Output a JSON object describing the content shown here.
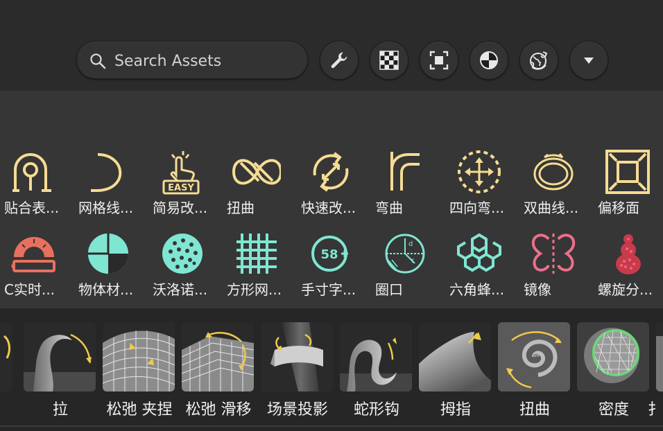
{
  "search": {
    "placeholder": "Search Assets"
  },
  "toolbar": {
    "buttons": [
      {
        "icon": "wrench-icon"
      },
      {
        "icon": "checkerboard-icon"
      },
      {
        "icon": "frame-icon"
      },
      {
        "icon": "material-sphere-icon"
      },
      {
        "icon": "globe-icon"
      },
      {
        "icon": "dropdown-arrow-icon"
      }
    ]
  },
  "colors": {
    "yellow": "#f6dc93",
    "salmon": "#e8705f",
    "mint": "#7fe6d2",
    "pink": "#ee6f8a",
    "red": "#c93a4a",
    "accent_arrow": "#f2c94c",
    "green_ring": "#6fd47a"
  },
  "grid": {
    "row1": [
      {
        "label": "贴合表...",
        "icon": "fit-surface-icon"
      },
      {
        "label": "网格线...",
        "icon": "mesh-curve-icon"
      },
      {
        "label": "简易改...",
        "icon": "easy-modify-icon"
      },
      {
        "label": "扭曲",
        "icon": "twist-icon"
      },
      {
        "label": "快速改...",
        "icon": "quick-modify-icon"
      },
      {
        "label": "弯曲",
        "icon": "bend-icon"
      },
      {
        "label": "四向弯...",
        "icon": "four-way-bend-icon"
      },
      {
        "label": "双曲线...",
        "icon": "double-curve-icon"
      },
      {
        "label": "偏移面",
        "icon": "offset-face-icon"
      }
    ],
    "row2": [
      {
        "label": "C实时...",
        "icon": "protractor-icon"
      },
      {
        "label": "物体材...",
        "icon": "object-material-icon"
      },
      {
        "label": "沃洛诺...",
        "icon": "voronoi-icon"
      },
      {
        "label": "方形网...",
        "icon": "square-grid-icon"
      },
      {
        "label": "手寸字...",
        "icon": "text-size-icon",
        "badge": "58"
      },
      {
        "label": "圈口",
        "icon": "ring-icon"
      },
      {
        "label": "六角蜂...",
        "icon": "hexagon-honeycomb-icon"
      },
      {
        "label": "镜像",
        "icon": "mirror-icon"
      },
      {
        "label": "螺旋分...",
        "icon": "spiral-split-icon"
      }
    ]
  },
  "brushes": [
    {
      "label": "",
      "icon": "partial-brush-icon"
    },
    {
      "label": "拉",
      "icon": "pull-brush-icon"
    },
    {
      "label": "松弛 夹捏",
      "icon": "relax-pinch-icon"
    },
    {
      "label": "松弛 滑移",
      "icon": "relax-slide-icon"
    },
    {
      "label": "场景投影",
      "icon": "scene-projection-icon"
    },
    {
      "label": "蛇形钩",
      "icon": "snake-hook-icon"
    },
    {
      "label": "拇指",
      "icon": "thumb-brush-icon"
    },
    {
      "label": "扭曲",
      "icon": "twist-brush-icon"
    },
    {
      "label": "密度",
      "icon": "density-brush-icon"
    },
    {
      "label": "扌",
      "icon": "partial-brush-icon"
    }
  ]
}
